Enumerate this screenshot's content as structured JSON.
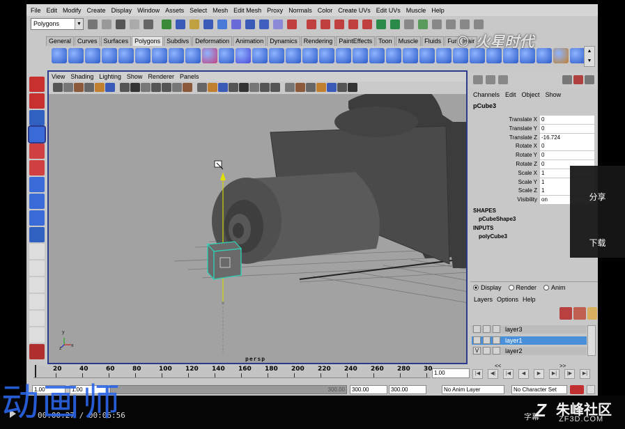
{
  "menubar": {
    "items": [
      "File",
      "Edit",
      "Modify",
      "Create",
      "Display",
      "Window",
      "Assets",
      "Select",
      "Mesh",
      "Edit Mesh",
      "Proxy",
      "Normals",
      "Color",
      "Create UVs",
      "Edit UVs",
      "Muscle",
      "Help"
    ]
  },
  "status_line": {
    "mode": "Polygons"
  },
  "shelf": {
    "tabs": [
      "General",
      "Curves",
      "Surfaces",
      "Polygons",
      "Subdivs",
      "Deformation",
      "Animation",
      "Dynamics",
      "Rendering",
      "PaintEffects",
      "Toon",
      "Muscle",
      "Fluids",
      "Fur",
      "Hair"
    ],
    "active_tab": "Polygons"
  },
  "logo_text": "© 火星时代",
  "viewport": {
    "panel_menu": [
      "View",
      "Shading",
      "Lighting",
      "Show",
      "Renderer",
      "Panels"
    ],
    "camera_label": "persp",
    "axis": {
      "y": "y",
      "x": "x",
      "z": "z"
    }
  },
  "channel_box": {
    "menu": [
      "Channels",
      "Edit",
      "Object",
      "Show"
    ],
    "object_name": "pCube3",
    "attributes": [
      {
        "label": "Translate X",
        "value": "0"
      },
      {
        "label": "Translate Y",
        "value": "0"
      },
      {
        "label": "Translate Z",
        "value": "-16.724"
      },
      {
        "label": "Rotate X",
        "value": "0"
      },
      {
        "label": "Rotate Y",
        "value": "0"
      },
      {
        "label": "Rotate Z",
        "value": "0"
      },
      {
        "label": "Scale X",
        "value": "1"
      },
      {
        "label": "Scale Y",
        "value": "1"
      },
      {
        "label": "Scale Z",
        "value": "1"
      },
      {
        "label": "Visibility",
        "value": "on"
      }
    ],
    "shapes_header": "SHAPES",
    "shape_name": "pCubeShape3",
    "inputs_header": "INPUTS",
    "input_name": "polyCube3"
  },
  "layer_editor": {
    "modes": [
      "Display",
      "Render",
      "Anim"
    ],
    "menu": [
      "Layers",
      "Options",
      "Help"
    ],
    "layers": [
      {
        "name": "layer3",
        "visible_mark": "",
        "selected": false
      },
      {
        "name": "layer1",
        "visible_mark": "",
        "selected": true
      },
      {
        "name": "layer2",
        "visible_mark": "V",
        "selected": false
      }
    ]
  },
  "time_slider": {
    "ticks": [
      "20",
      "40",
      "60",
      "80",
      "100",
      "120",
      "140",
      "160",
      "180",
      "200",
      "220",
      "240",
      "260",
      "280",
      "30"
    ],
    "current_frame": "1.00",
    "nav_back": "<<",
    "nav_fwd": ">>"
  },
  "range_slider": {
    "start": "1.00",
    "playback_start": "1.00",
    "playback_end_label": "300.00",
    "end": "300.00",
    "end2": "300.00",
    "anim_layer": "No Anim Layer",
    "char_set": "No Character Set"
  },
  "overlay": {
    "share": "分享",
    "download": "下载"
  },
  "video": {
    "time": "00:00:27 / 00:06:56",
    "watermark_left": "动画师",
    "watermark_right_big": "朱峰社区",
    "watermark_right_small": "ZF3D.COM",
    "subtitle_prefix": "字幕"
  }
}
